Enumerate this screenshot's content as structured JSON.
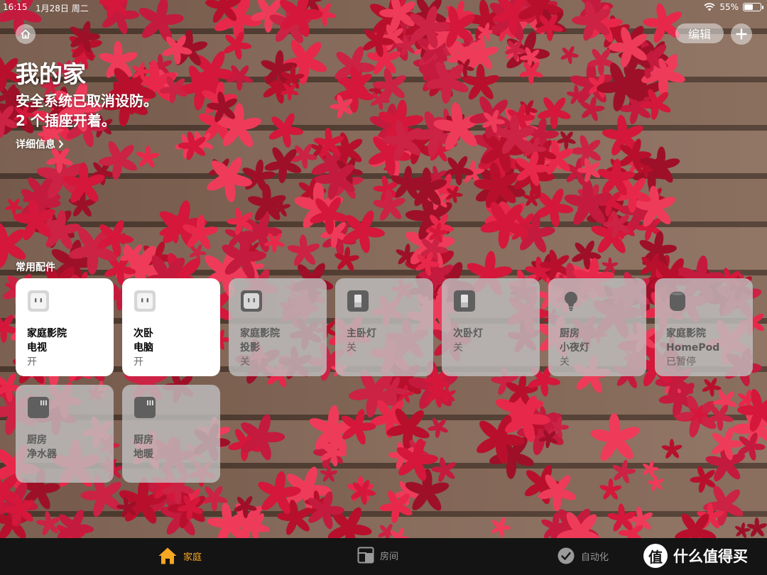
{
  "status_bar": {
    "time": "16:15",
    "date": "1月28日 周二",
    "battery_percent": "55%",
    "battery_level": 0.55
  },
  "header": {
    "edit_label": "编辑",
    "title": "我的家",
    "summary_line1": "安全系统已取消设防。",
    "summary_line2": "2 个插座开着。",
    "details_label": "详细信息"
  },
  "section_label": "常用配件",
  "tiles": [
    {
      "icon": "outlet-icon",
      "room": "家庭影院",
      "name": "电视",
      "state": "开",
      "on": true
    },
    {
      "icon": "outlet-icon",
      "room": "次卧",
      "name": "电脑",
      "state": "开",
      "on": true
    },
    {
      "icon": "outlet-icon",
      "room": "家庭影院",
      "name": "投影",
      "state": "关",
      "on": false
    },
    {
      "icon": "light-switch-icon",
      "room": "",
      "name": "主卧灯",
      "state": "关",
      "on": false
    },
    {
      "icon": "light-switch-icon",
      "room": "",
      "name": "次卧灯",
      "state": "关",
      "on": false
    },
    {
      "icon": "lightbulb-icon",
      "room": "厨房",
      "name": "小夜灯",
      "state": "关",
      "on": false
    },
    {
      "icon": "homepod-icon",
      "room": "家庭影院",
      "name": "HomePod",
      "state": "已暂停",
      "on": false
    },
    {
      "icon": "switch-box-icon",
      "room": "厨房",
      "name": "净水器",
      "state": "",
      "on": false
    },
    {
      "icon": "switch-box-icon",
      "room": "厨房",
      "name": "地暖",
      "state": "",
      "on": false
    }
  ],
  "tab_bar": {
    "tabs": [
      {
        "label": "家庭",
        "icon": "house-icon",
        "active": true
      },
      {
        "label": "房间",
        "icon": "rooms-icon",
        "active": false
      },
      {
        "label": "自动化",
        "icon": "automation-icon",
        "active": false
      }
    ],
    "active_color": "#f5a623",
    "watermark_glyph": "值",
    "watermark_text": "什么值得买"
  }
}
